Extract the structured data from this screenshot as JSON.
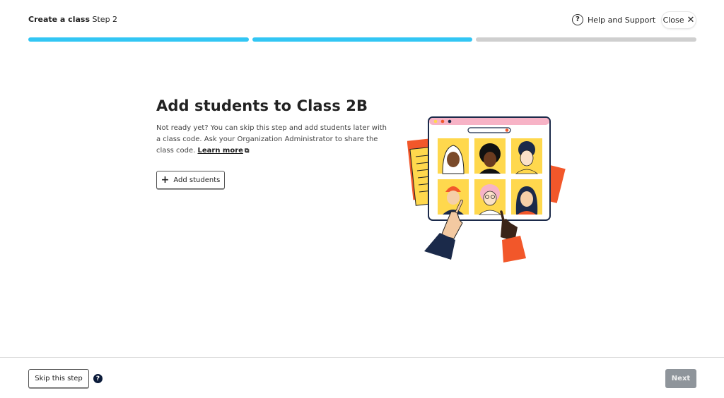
{
  "header": {
    "title_bold": "Create a class",
    "title_step": "Step 2",
    "help_label": "Help and Support",
    "help_icon": "?",
    "close_label": "Close",
    "close_icon": "✕"
  },
  "progress": {
    "total_steps": 3,
    "completed_steps": 2,
    "active_color": "#32c6f4",
    "inactive_color": "#cfcfcf"
  },
  "main": {
    "title": "Add students to Class 2B",
    "description": "Not ready yet? You can skip this step and add students later with a class code. Ask your Organization Administrator to share the class code.",
    "learn_more_label": "Learn more",
    "add_students_label": "Add students",
    "add_icon": "+"
  },
  "footer": {
    "skip_label": "Skip this step",
    "help_icon": "?",
    "next_label": "Next"
  }
}
